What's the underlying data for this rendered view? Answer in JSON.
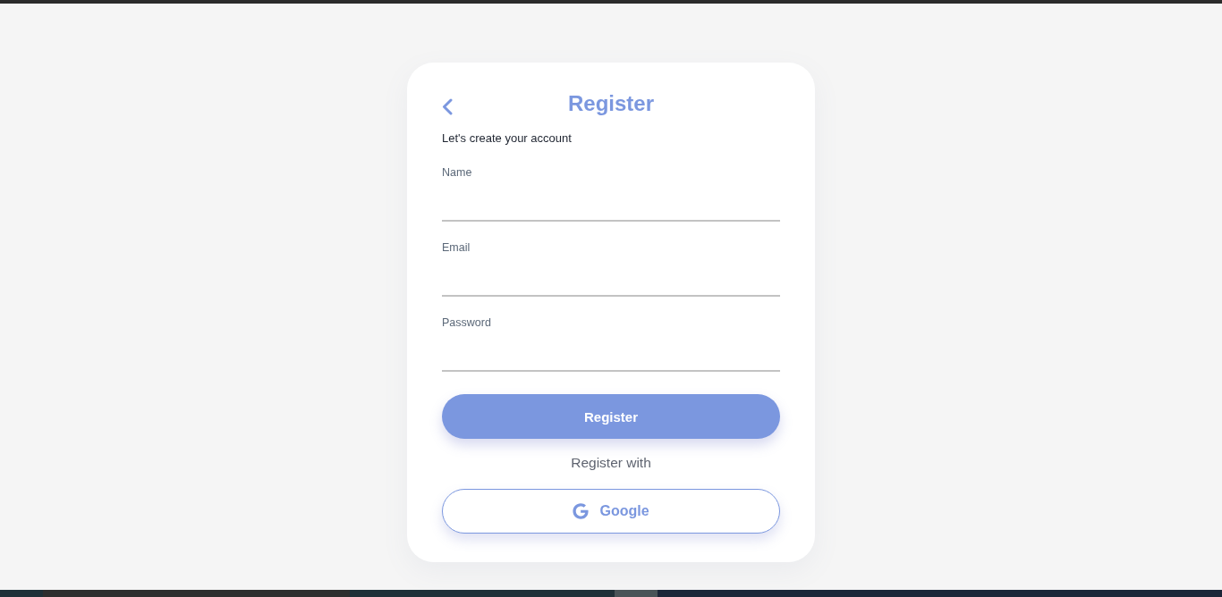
{
  "header": {
    "title": "Register"
  },
  "subtitle": "Let's create your account",
  "fields": [
    {
      "label": "Name"
    },
    {
      "label": "Email"
    },
    {
      "label": "Password"
    }
  ],
  "primary_button": {
    "label": "Register"
  },
  "divider_text": "Register with",
  "social_buttons": [
    {
      "kind": "google",
      "label": "Google"
    }
  ]
}
